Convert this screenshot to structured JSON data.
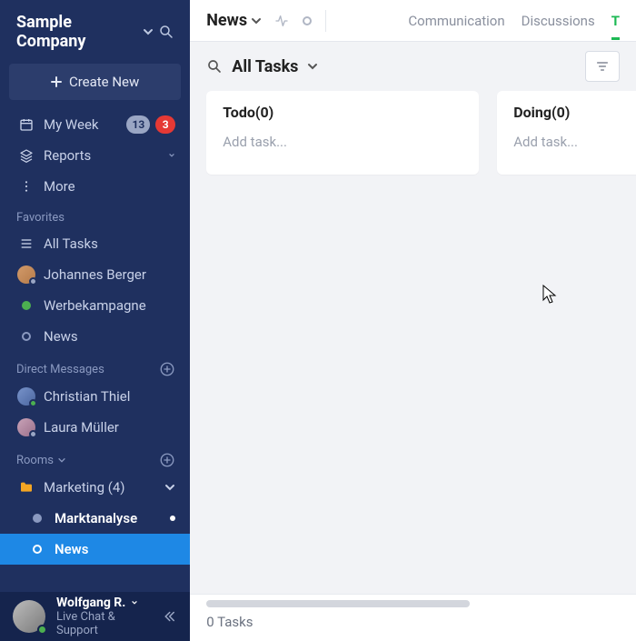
{
  "sidebar": {
    "company": "Sample Company",
    "create_label": "Create New",
    "nav": {
      "myweek": "My Week",
      "myweek_badge_gray": "13",
      "myweek_badge_red": "3",
      "reports": "Reports",
      "more": "More"
    },
    "favorites_header": "Favorites",
    "favorites": [
      {
        "label": "All Tasks"
      },
      {
        "label": "Johannes Berger",
        "presence": "offline"
      },
      {
        "label": "Werbekampagne",
        "dot_color": "#4caf50"
      },
      {
        "label": "News"
      }
    ],
    "dm_header": "Direct Messages",
    "dms": [
      {
        "label": "Christian Thiel",
        "presence": "online"
      },
      {
        "label": "Laura Müller",
        "presence": "offline"
      }
    ],
    "rooms_header": "Rooms",
    "room_group": "Marketing (4)",
    "room_children": [
      {
        "label": "Marktanalyse",
        "unread": true
      },
      {
        "label": "News",
        "active": true
      }
    ],
    "footer": {
      "name": "Wolfgang R.",
      "sub": "Live Chat & Support"
    }
  },
  "main": {
    "title": "News",
    "tabs": {
      "communication": "Communication",
      "discussions": "Discussions",
      "tasks_initial": "T"
    },
    "toolbar": {
      "selector": "All Tasks"
    },
    "columns": [
      {
        "title": "Todo(0)",
        "placeholder": "Add task..."
      },
      {
        "title": "Doing(0)",
        "placeholder": "Add task..."
      }
    ],
    "footer_count": "0 Tasks"
  }
}
